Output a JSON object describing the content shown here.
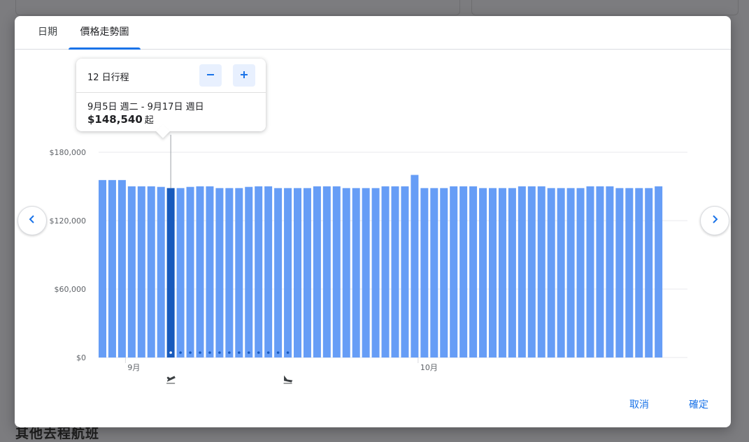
{
  "background": {
    "heading": "其他去程航班"
  },
  "tabs": [
    {
      "label": "日期",
      "active": false
    },
    {
      "label": "價格走勢圖",
      "active": true
    }
  ],
  "popup": {
    "trip_length": "12 日行程",
    "dates": "9月5日 週二 - 9月17日 週日",
    "price": "$148,540",
    "price_suffix": "起"
  },
  "nav": {
    "prev_icon": "chevron-left-icon",
    "next_icon": "chevron-right-icon"
  },
  "actions": {
    "cancel": "取消",
    "confirm": "確定"
  },
  "colors": {
    "bar": "#669df6",
    "bar_selected": "#185abc",
    "accent": "#1a73e8"
  },
  "chart_data": {
    "type": "bar",
    "ylim": [
      0,
      180000
    ],
    "y_ticks": [
      "$0",
      "$60,000",
      "$120,000",
      "$180,000"
    ],
    "y_tick_values": [
      0,
      60000,
      120000,
      180000
    ],
    "x_labels": [
      {
        "index": 3,
        "label": "9月"
      },
      {
        "index": 33,
        "label": "10月"
      }
    ],
    "values": [
      155600,
      155600,
      155600,
      150100,
      150100,
      150100,
      149600,
      148540,
      148540,
      149600,
      150100,
      150100,
      148540,
      148540,
      148540,
      149600,
      150100,
      150100,
      148540,
      148540,
      148540,
      148540,
      150100,
      150100,
      150100,
      148540,
      148540,
      148540,
      148540,
      150100,
      150100,
      150100,
      160100,
      148540,
      148540,
      148540,
      150100,
      150100,
      150100,
      148540,
      148540,
      148540,
      148540,
      150100,
      150100,
      150100,
      148540,
      148540,
      148540,
      148540,
      150100,
      150100,
      150100,
      148540,
      148540,
      148540,
      148540,
      150100
    ],
    "selected_index": 7,
    "trip_dot_indices": [
      7,
      8,
      9,
      10,
      11,
      12,
      13,
      14,
      15,
      16,
      17,
      18,
      19
    ],
    "departure_index": 7,
    "return_index": 19,
    "departure_icon": "flight-takeoff-icon",
    "return_icon": "flight-land-icon"
  }
}
